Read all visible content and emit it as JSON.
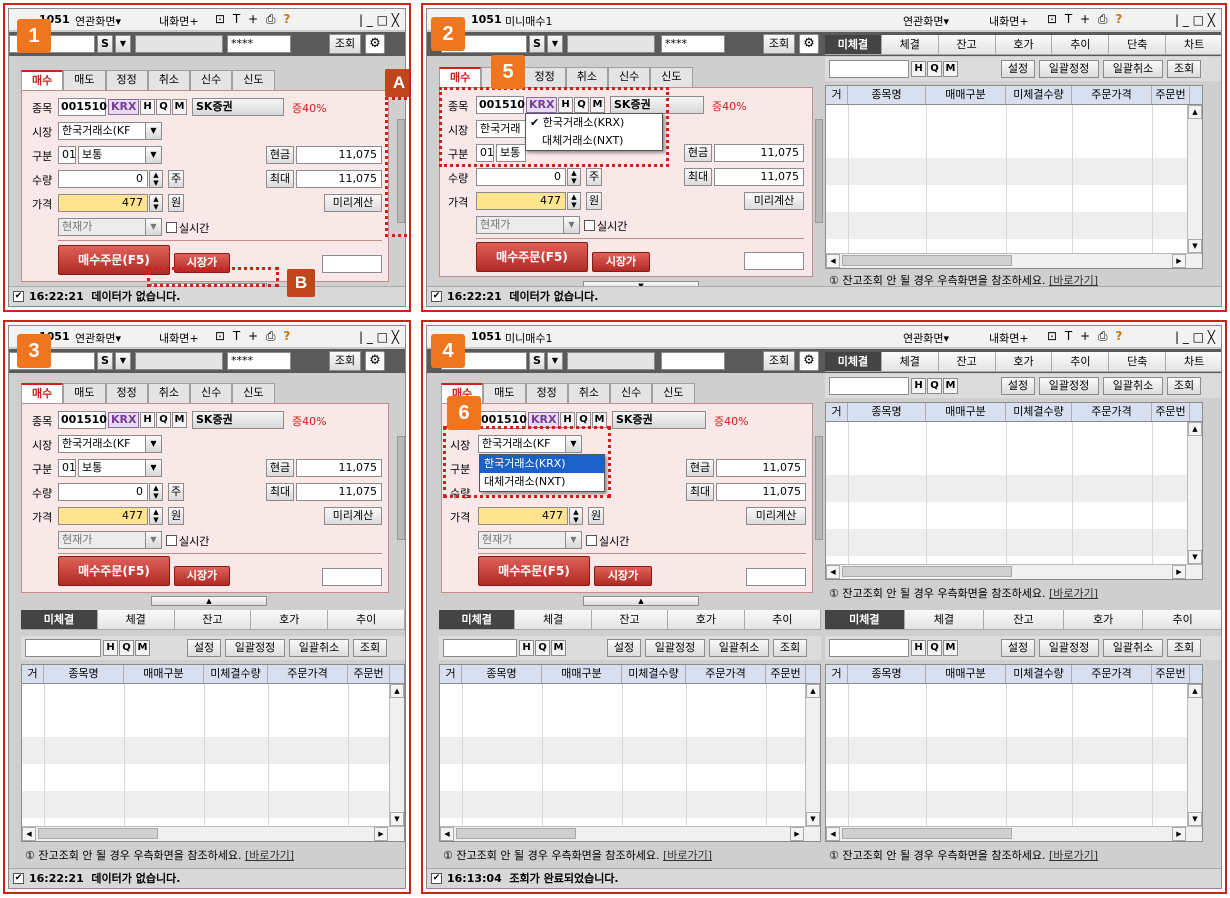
{
  "panels": [
    {
      "badge": "1"
    },
    {
      "badge": "2"
    },
    {
      "badge": "3"
    },
    {
      "badge": "4"
    }
  ],
  "callouts": {
    "a": "A",
    "b": "B",
    "c5": "5",
    "c6": "6"
  },
  "window": {
    "screen_no_mini": "1051",
    "screen_no": "1051",
    "title_mini": "미니매수1",
    "related_menu": "연관화면▾",
    "my_screen": "내화면+",
    "close_icon": "╳",
    "icons": "⊡ T + ⎙",
    "help": "?"
  },
  "toolbar": {
    "s_label": "S",
    "password_mask": "****",
    "query_button": "조회"
  },
  "order_tabs": [
    "매수",
    "매도",
    "정정",
    "취소",
    "신수",
    "신도"
  ],
  "order": {
    "stock_label": "종목",
    "stock_code": "001510",
    "market_badge": "KRX",
    "btn_h": "H",
    "btn_q": "Q",
    "btn_m": "M",
    "stock_name": "SK증권",
    "margin": "증40%",
    "market_label": "시장",
    "market_value": "한국거래소(KF",
    "market_value_short": "한국거래",
    "type_label": "구분",
    "type_code": "01",
    "type_value": "보통",
    "type_value_short": "보통",
    "qty_label": "수량",
    "qty_value": "0",
    "qty_unit": "주",
    "price_label": "가격",
    "price_value": "477",
    "price_unit": "원",
    "price_type": "현재가",
    "realtime_label": "실시간",
    "cash_label": "현금",
    "cash_value": "11,075",
    "max_label": "최대",
    "max_value": "11,075",
    "precalc_button": "미리계산",
    "buy_button": "매수주문(F5)",
    "market_order_button": "시장가"
  },
  "market_dropdown": {
    "check": "✔",
    "krx": "한국거래소(KRX)",
    "nxt": "대체거래소(NXT)"
  },
  "position_tabs": [
    "미체결",
    "체결",
    "잔고",
    "호가",
    "추이",
    "단축",
    "차트"
  ],
  "position_bar": {
    "btn_h": "H",
    "btn_q": "Q",
    "btn_m": "M",
    "settings": "설정",
    "bulk_modify": "일괄정정",
    "bulk_cancel": "일괄취소",
    "query": "조회"
  },
  "grid_columns": [
    "거",
    "종목명",
    "매매구분",
    "미체결수량",
    "주문가격",
    "주문번"
  ],
  "info": {
    "icon": "①",
    "text": "잔고조회 안 될 경우 우측화면을 참조하세요.",
    "link": "[바로가기]"
  },
  "status": {
    "time1": "16:22:21",
    "msg1": "데이터가 없습니다.",
    "time4": "16:13:04",
    "msg4": "조회가 완료되었습니다."
  },
  "accent_color": "#d0201c"
}
